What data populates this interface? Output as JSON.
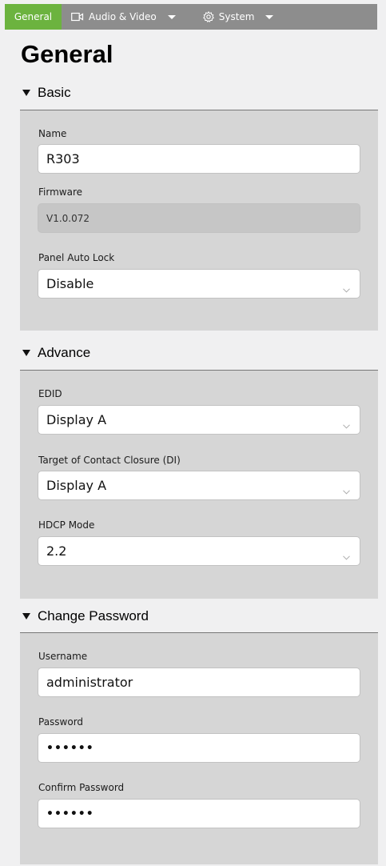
{
  "nav": {
    "general": "General",
    "audio_video": "Audio & Video",
    "system": "System"
  },
  "page_title": "General",
  "basic": {
    "header": "Basic",
    "name_label": "Name",
    "name_value": "R303",
    "firmware_label": "Firmware",
    "firmware_value": "V1.0.072",
    "autolock_label": "Panel Auto Lock",
    "autolock_value": "Disable"
  },
  "advance": {
    "header": "Advance",
    "edid_label": "EDID",
    "edid_value": "Display A",
    "target_label": "Target of Contact Closure (DI)",
    "target_value": "Display A",
    "hdcp_label": "HDCP Mode",
    "hdcp_value": "2.2"
  },
  "password": {
    "header": "Change Password",
    "username_label": "Username",
    "username_value": "administrator",
    "password_label": "Password",
    "password_value": "••••••",
    "confirm_label": "Confirm Password",
    "confirm_value": "••••••"
  }
}
